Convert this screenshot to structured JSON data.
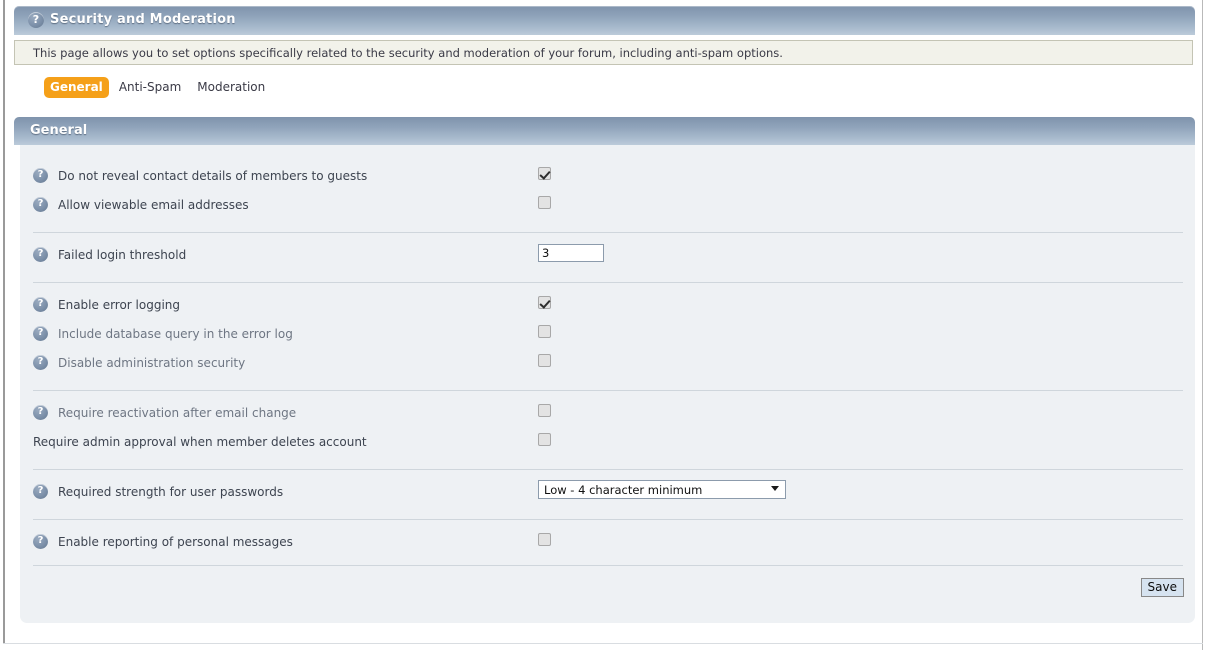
{
  "window": {
    "title": "Security and Moderation",
    "help_icon": "question-mark-icon"
  },
  "description": "This page allows you to set options specifically related to the security and moderation of your forum, including anti-spam options.",
  "tabs": [
    {
      "label": "General",
      "active": true
    },
    {
      "label": "Anti-Spam",
      "active": false
    },
    {
      "label": "Moderation",
      "active": false
    }
  ],
  "section": {
    "title": "General"
  },
  "settings": [
    {
      "label": "Do not reveal contact details of members to guests",
      "help": true,
      "type": "checkbox",
      "checked": true,
      "dim": false
    },
    {
      "label": "Allow viewable email addresses",
      "help": true,
      "type": "checkbox",
      "checked": false,
      "dim": false
    },
    {
      "label": "Failed login threshold",
      "help": true,
      "type": "text",
      "value": "3",
      "dim": false
    },
    {
      "label": "Enable error logging",
      "help": true,
      "type": "checkbox",
      "checked": true,
      "dim": false
    },
    {
      "label": "Include database query in the error log",
      "help": true,
      "type": "checkbox",
      "checked": false,
      "dim": true
    },
    {
      "label": "Disable administration security",
      "help": true,
      "type": "checkbox",
      "checked": false,
      "dim": true
    },
    {
      "label": "Require reactivation after email change",
      "help": true,
      "type": "checkbox",
      "checked": false,
      "dim": true
    },
    {
      "label": "Require admin approval when member deletes account",
      "help": false,
      "type": "checkbox",
      "checked": false,
      "dim": false
    },
    {
      "label": "Required strength for user passwords",
      "help": true,
      "type": "select",
      "value": "Low - 4 character minimum",
      "dim": false
    },
    {
      "label": "Enable reporting of personal messages",
      "help": true,
      "type": "checkbox",
      "checked": false,
      "dim": false
    }
  ],
  "groups": [
    [
      0,
      1
    ],
    [
      2
    ],
    [
      3,
      4,
      5
    ],
    [
      6,
      7
    ],
    [
      8
    ],
    [
      9
    ]
  ],
  "footer": {
    "save_label": "Save"
  },
  "colors": {
    "accent_orange": "#f5a019",
    "header_blue": "#8fa3ba",
    "panel_bg": "#eef1f4",
    "desc_bg": "#f2f2ea",
    "save_bg": "#d6e3f0"
  }
}
